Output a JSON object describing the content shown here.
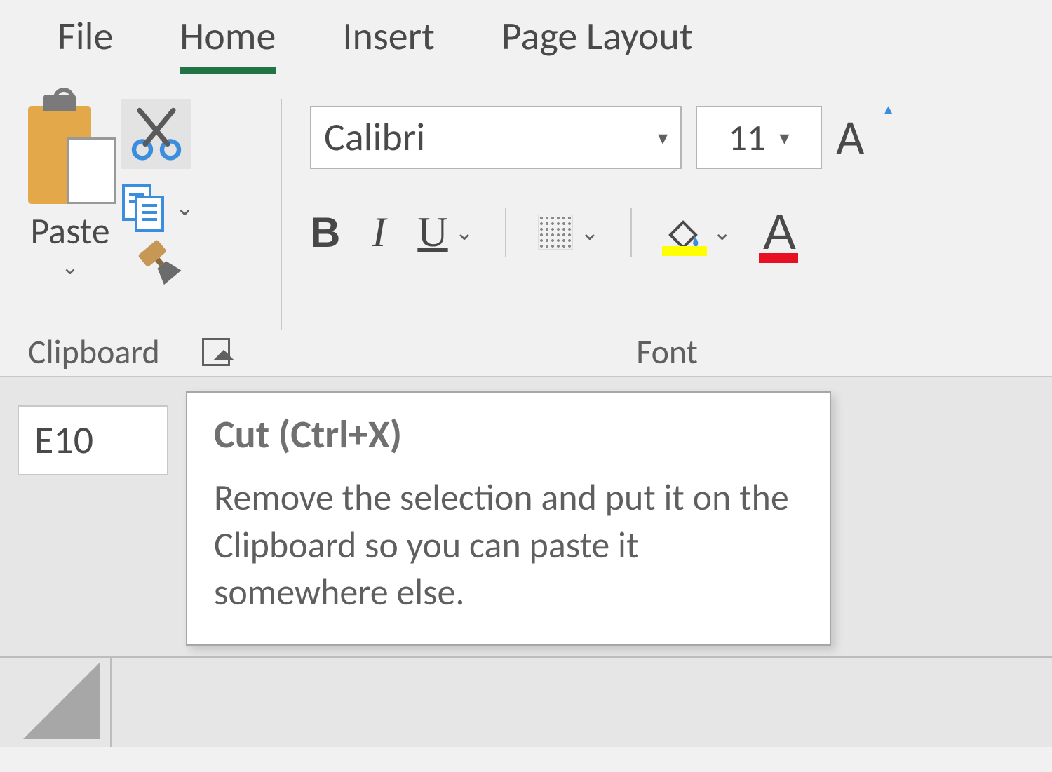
{
  "tabs": {
    "file": "File",
    "home": "Home",
    "insert": "Insert",
    "pagelayout": "Page Layout",
    "active": "home"
  },
  "clipboard": {
    "groupLabel": "Clipboard",
    "paste": "Paste"
  },
  "font": {
    "groupLabel": "Font",
    "name": "Calibri",
    "size": "11",
    "bold": "B",
    "italic": "I",
    "underline": "U",
    "grow": "A"
  },
  "cellref": "E10",
  "tooltip": {
    "title": "Cut (Ctrl+X)",
    "body": "Remove the selection and put it on the Clipboard so you can paste it somewhere else."
  }
}
